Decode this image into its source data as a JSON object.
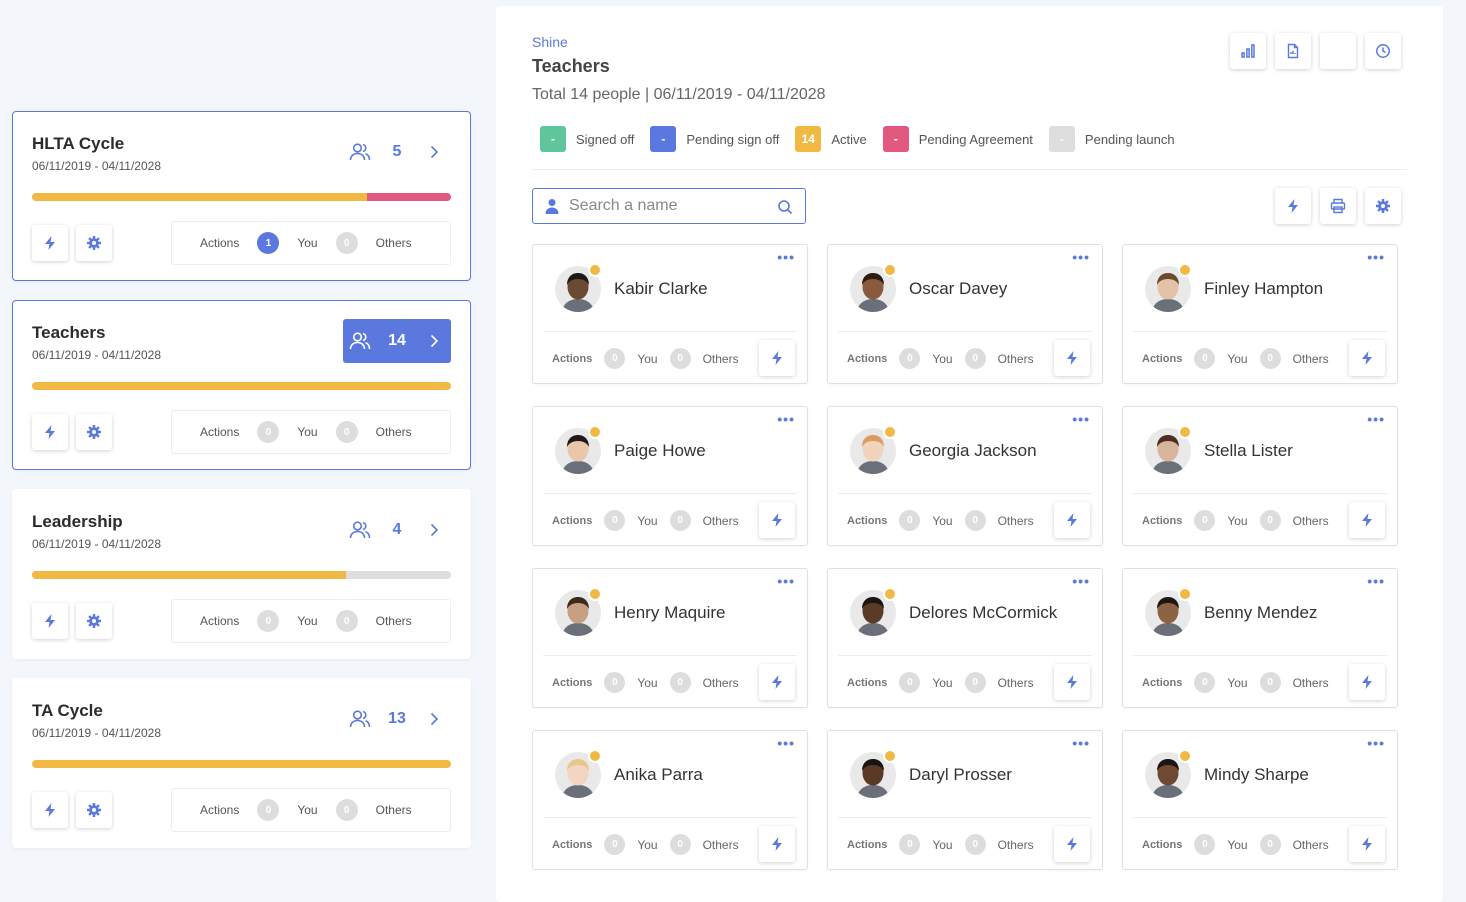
{
  "colors": {
    "accent": "#5b78de",
    "yellow": "#f1b944",
    "pink": "#e3587e",
    "green": "#5fc59a",
    "gray": "#dedede"
  },
  "groups": [
    {
      "title": "HLTA Cycle",
      "dates": "06/11/2019 - 04/11/2028",
      "count": "5",
      "selected": true,
      "active": false,
      "progress": [
        {
          "color": "#f1b944",
          "fraction": 0.8
        },
        {
          "color": "#e3587e",
          "fraction": 0.2
        }
      ],
      "actions_label": "Actions",
      "you_count": "1",
      "you_label": "You",
      "others_count": "0",
      "others_label": "Others"
    },
    {
      "title": "Teachers",
      "dates": "06/11/2019 - 04/11/2028",
      "count": "14",
      "selected": true,
      "active": true,
      "progress": [
        {
          "color": "#f1b944",
          "fraction": 1.0
        }
      ],
      "actions_label": "Actions",
      "you_count": "0",
      "you_label": "You",
      "others_count": "0",
      "others_label": "Others"
    },
    {
      "title": "Leadership",
      "dates": "06/11/2019 - 04/11/2028",
      "count": "4",
      "selected": false,
      "active": false,
      "progress": [
        {
          "color": "#f1b944",
          "fraction": 0.75
        }
      ],
      "actions_label": "Actions",
      "you_count": "0",
      "you_label": "You",
      "others_count": "0",
      "others_label": "Others"
    },
    {
      "title": "TA Cycle",
      "dates": "06/11/2019 - 04/11/2028",
      "count": "13",
      "selected": false,
      "active": false,
      "progress": [
        {
          "color": "#f1b944",
          "fraction": 1.0
        }
      ],
      "actions_label": "Actions",
      "you_count": "0",
      "you_label": "You",
      "others_count": "0",
      "others_label": "Others"
    }
  ],
  "main": {
    "breadcrumb": "Shine",
    "title": "Teachers",
    "total": "Total 14 people | 06/11/2019 - 04/11/2028",
    "legend": [
      {
        "value": "-",
        "label": "Signed off",
        "color": "#5fc59a"
      },
      {
        "value": "-",
        "label": "Pending sign off",
        "color": "#5b78de"
      },
      {
        "value": "14",
        "label": "Active",
        "color": "#f1b944"
      },
      {
        "value": "-",
        "label": "Pending Agreement",
        "color": "#e3587e"
      },
      {
        "value": "-",
        "label": "Pending launch",
        "color": "#dedede"
      }
    ],
    "search": {
      "placeholder": "Search a name"
    }
  },
  "people": [
    {
      "name": "Kabir Clarke",
      "skin": "#6b4a34",
      "hair": "#1e1a17"
    },
    {
      "name": "Oscar Davey",
      "skin": "#8a5a3c",
      "hair": "#2a1d14"
    },
    {
      "name": "Finley Hampton",
      "skin": "#e4c2a8",
      "hair": "#6a4a32"
    },
    {
      "name": "Paige Howe",
      "skin": "#e8c7ab",
      "hair": "#1f1a18"
    },
    {
      "name": "Georgia Jackson",
      "skin": "#f0d4bc",
      "hair": "#d99d62"
    },
    {
      "name": "Stella Lister",
      "skin": "#d8b49a",
      "hair": "#4a2e20"
    },
    {
      "name": "Henry Maquire",
      "skin": "#c79f82",
      "hair": "#3b2a1e"
    },
    {
      "name": "Delores McCormick",
      "skin": "#5b3a26",
      "hair": "#1b1513"
    },
    {
      "name": "Benny Mendez",
      "skin": "#8d6346",
      "hair": "#1e1714"
    },
    {
      "name": "Anika Parra",
      "skin": "#f2d6c2",
      "hair": "#e8c68e"
    },
    {
      "name": "Daryl Prosser",
      "skin": "#5a3a26",
      "hair": "#1a1411"
    },
    {
      "name": "Mindy Sharpe",
      "skin": "#6e4a33",
      "hair": "#1c1512"
    }
  ],
  "person_actions": {
    "actions_label": "Actions",
    "you_count": "0",
    "you_label": "You",
    "others_count": "0",
    "others_label": "Others"
  }
}
